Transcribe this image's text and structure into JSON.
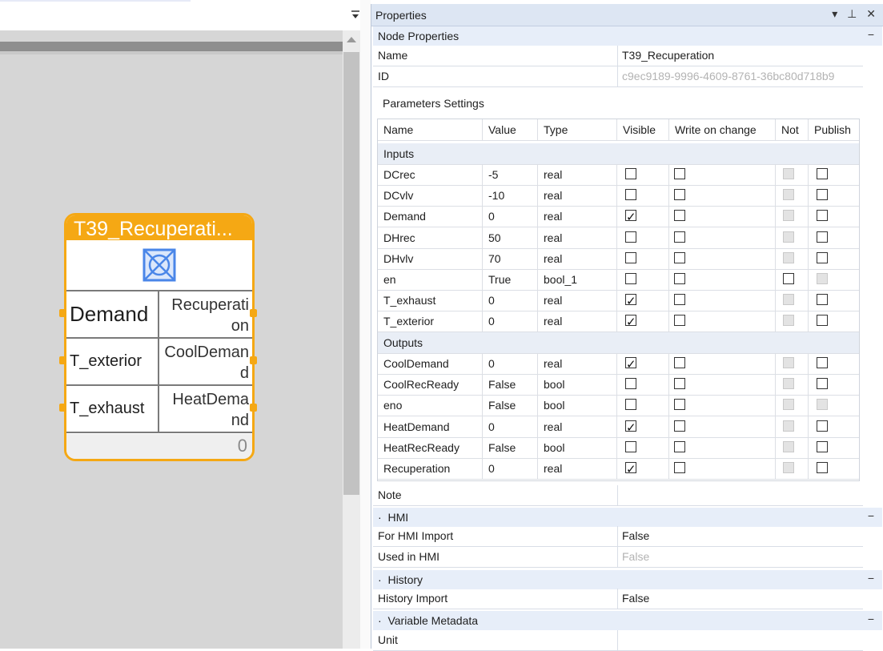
{
  "properties_panel": {
    "title": "Properties",
    "buttons": [
      "▾",
      "⊥",
      "✕"
    ]
  },
  "node": {
    "title": "T39_Recuperati...",
    "inputs": [
      "Demand",
      "T_exterior",
      "T_exhaust"
    ],
    "outputs": [
      "Recuperati\non",
      "CoolDeman\nd",
      "HeatDema\nnd"
    ],
    "footer_value": "0",
    "accent_color": "#f5a814"
  },
  "node_properties": {
    "section_label": "Node Properties",
    "collapse": "−",
    "name_label": "Name",
    "name_value": "T39_Recuperation",
    "id_label": "ID",
    "id_value": "c9ec9189-9996-4609-8761-36bc80d718b9"
  },
  "parameters": {
    "title": "Parameters Settings",
    "columns": [
      "Name",
      "Value",
      "Type",
      "Visible",
      "Write on change",
      "Not",
      "Publish"
    ],
    "inputs_label": "Inputs",
    "outputs_label": "Outputs",
    "inputs": [
      {
        "name": "DCrec",
        "value": "-5",
        "type": "real",
        "visible": false,
        "write": false,
        "not_enabled": false,
        "publish": false,
        "publish_enabled": true
      },
      {
        "name": "DCvlv",
        "value": "-10",
        "type": "real",
        "visible": false,
        "write": false,
        "not_enabled": false,
        "publish": false,
        "publish_enabled": true
      },
      {
        "name": "Demand",
        "value": "0",
        "type": "real",
        "visible": true,
        "write": false,
        "not_enabled": false,
        "publish": false,
        "publish_enabled": true
      },
      {
        "name": "DHrec",
        "value": "50",
        "type": "real",
        "visible": false,
        "write": false,
        "not_enabled": false,
        "publish": false,
        "publish_enabled": true
      },
      {
        "name": "DHvlv",
        "value": "70",
        "type": "real",
        "visible": false,
        "write": false,
        "not_enabled": false,
        "publish": false,
        "publish_enabled": true
      },
      {
        "name": "en",
        "value": "True",
        "type": "bool_1",
        "visible": false,
        "write": false,
        "not_enabled": true,
        "publish": false,
        "publish_enabled": false
      },
      {
        "name": "T_exhaust",
        "value": "0",
        "type": "real",
        "visible": true,
        "write": false,
        "not_enabled": false,
        "publish": false,
        "publish_enabled": true
      },
      {
        "name": "T_exterior",
        "value": "0",
        "type": "real",
        "visible": true,
        "write": false,
        "not_enabled": false,
        "publish": false,
        "publish_enabled": true
      }
    ],
    "outputs": [
      {
        "name": "CoolDemand",
        "value": "0",
        "type": "real",
        "visible": true,
        "write": false,
        "not_enabled": false,
        "publish": false,
        "publish_enabled": true
      },
      {
        "name": "CoolRecReady",
        "value": "False",
        "type": "bool",
        "visible": false,
        "write": false,
        "not_enabled": false,
        "publish": false,
        "publish_enabled": true
      },
      {
        "name": "eno",
        "value": "False",
        "type": "bool",
        "visible": false,
        "write": false,
        "not_enabled": false,
        "publish": false,
        "publish_enabled": false
      },
      {
        "name": "HeatDemand",
        "value": "0",
        "type": "real",
        "visible": true,
        "write": false,
        "not_enabled": false,
        "publish": false,
        "publish_enabled": true
      },
      {
        "name": "HeatRecReady",
        "value": "False",
        "type": "bool",
        "visible": false,
        "write": false,
        "not_enabled": false,
        "publish": false,
        "publish_enabled": true
      },
      {
        "name": "Recuperation",
        "value": "0",
        "type": "real",
        "visible": true,
        "write": false,
        "not_enabled": false,
        "publish": false,
        "publish_enabled": true
      }
    ]
  },
  "note_label": "Note",
  "hmi": {
    "section_label": "HMI",
    "bullet": "·",
    "collapse": "−",
    "for_hmi_import_label": "For HMI Import",
    "for_hmi_import_value": "False",
    "used_in_hmi_label": "Used in HMI",
    "used_in_hmi_value": "False"
  },
  "history": {
    "section_label": "History",
    "bullet": "·",
    "collapse": "−",
    "history_import_label": "History Import",
    "history_import_value": "False"
  },
  "variable_metadata": {
    "section_label": "Variable Metadata",
    "bullet": "·",
    "collapse": "−",
    "unit_label": "Unit"
  }
}
